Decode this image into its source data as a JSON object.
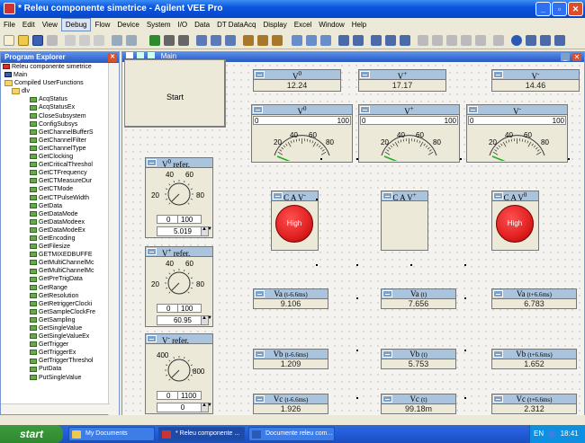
{
  "app": {
    "title": "* Releu componente simetrice - Agilent VEE Pro"
  },
  "menu": [
    "File",
    "Edit",
    "View",
    "Debug",
    "Flow",
    "Device",
    "System",
    "I/O",
    "Data",
    "DT DataAcq",
    "Display",
    "Excel",
    "Window",
    "Help"
  ],
  "explorer": {
    "title": "Program Explorer",
    "root": "Releu componente simetrice",
    "main": "Main",
    "compiled": "Compiled UserFunctions",
    "folder": "dlv",
    "functions": [
      "AcqStatus",
      "AcqStatusEx",
      "CloseSubsystem",
      "ConfigSubsys",
      "GetChannelBufferS",
      "GetChannelFilter",
      "GetChannelType",
      "GetClocking",
      "GetCriticalThreshol",
      "GetCTFrequency",
      "GetCTMeasureDur",
      "GetCTMode",
      "GetCTPulseWidth",
      "GetData",
      "GetDataMode",
      "GetDataModeex",
      "GetDataModeEx",
      "GetEncoding",
      "GetFilesize",
      "GETMIXEDBUFFE",
      "GetMultiChannelMc",
      "GetMultiChannelMc",
      "GetPreTrigData",
      "GetRange",
      "GetResolution",
      "GetRetriggerClocki",
      "GetSampleClockFre",
      "GetSampling",
      "GetSingleValue",
      "GetSingleValueEx",
      "GetTrigger",
      "GetTriggerEx",
      "GetTriggerThreshol",
      "PutData",
      "PutSingleValue"
    ]
  },
  "main_window": {
    "title": "Main"
  },
  "start": {
    "label": "Start"
  },
  "displays": [
    {
      "label": "V",
      "sup": "0",
      "value": "12.24"
    },
    {
      "label": "V",
      "sup": "+",
      "value": "17.17"
    },
    {
      "label": "V",
      "sup": "-",
      "value": "14.46"
    }
  ],
  "meters": [
    {
      "label": "V",
      "sup": "0",
      "min": "0",
      "max": "100"
    },
    {
      "label": "V",
      "sup": "+",
      "min": "0",
      "max": "100"
    },
    {
      "label": "V",
      "sup": "-",
      "min": "0",
      "max": "100"
    }
  ],
  "meter_ticks": [
    "20",
    "40",
    "60",
    "80"
  ],
  "knobs": [
    {
      "label": "V",
      "sup": "0",
      "suffix": " refer.",
      "min": "0",
      "max": "100",
      "value": "5.019",
      "ticks": [
        "40",
        "60",
        "20",
        "80"
      ]
    },
    {
      "label": "V",
      "sup": "+",
      "suffix": " refer.",
      "min": "0",
      "max": "100",
      "value": "60.95",
      "ticks": [
        "40",
        "60",
        "20",
        "80"
      ]
    },
    {
      "label": "V",
      "sup": "-",
      "suffix": " refer.",
      "min": "0",
      "max": "1100",
      "value": "0",
      "ticks": [
        "400",
        "800"
      ]
    }
  ],
  "alarms": [
    {
      "label": "C A V",
      "sup": "-",
      "state": "High",
      "on": true
    },
    {
      "label": "C A V",
      "sup": "+",
      "state": "",
      "on": false
    },
    {
      "label": "C A V",
      "sup": "0",
      "state": "High",
      "on": true
    }
  ],
  "values": [
    {
      "name": "Va",
      "tag": "(t-6.6ms)",
      "value": "9.106"
    },
    {
      "name": "Va",
      "tag": "(t)",
      "value": "7.656"
    },
    {
      "name": "Va",
      "tag": "(t+6.6ms)",
      "value": "6.783"
    },
    {
      "name": "Vb",
      "tag": "(t-6.6ms)",
      "value": "1.209"
    },
    {
      "name": "Vb",
      "tag": "(t)",
      "value": "5.753"
    },
    {
      "name": "Vb",
      "tag": "(t+6.6ms)",
      "value": "1.652"
    },
    {
      "name": "Vc",
      "tag": "(t-6.6ms)",
      "value": "1.926"
    },
    {
      "name": "Vc",
      "tag": "(t)",
      "value": "99.18m"
    },
    {
      "name": "Vc",
      "tag": "(t+6.6ms)",
      "value": "2.312"
    }
  ],
  "taskbar": {
    "start": "start",
    "tasks": [
      "My Documents",
      "* Releu componente ...",
      "Documente releu com..."
    ],
    "lang": "EN",
    "clock": "18:41"
  },
  "colors": {
    "titlebar": "#0a55df",
    "panel_head": "#aac4de",
    "alarm_red": "#e02020",
    "canvas": "#f4f3f0"
  }
}
